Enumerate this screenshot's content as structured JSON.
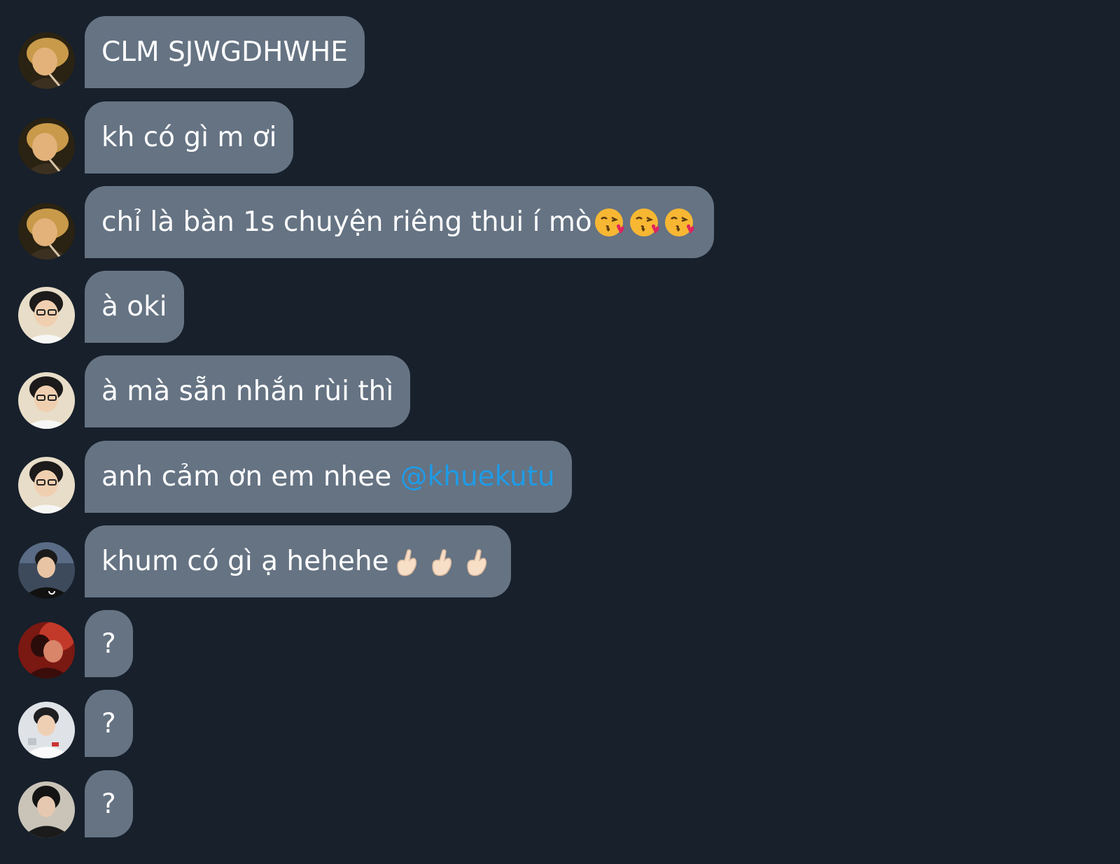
{
  "colors": {
    "background": "#17202b",
    "bubble": "#657383",
    "text": "#ffffff",
    "mention": "#1f9be6"
  },
  "messages": [
    {
      "text": "CLM SJWGDHWHE",
      "avatar": "avatar-blond"
    },
    {
      "text": "kh có gì m ơi",
      "avatar": "avatar-blond"
    },
    {
      "text": "chỉ là bàn 1s chuyện riêng thui í mò",
      "emoji": "kiss-emoji",
      "emoji_count": 3,
      "avatar": "avatar-blond"
    },
    {
      "text": "à oki",
      "avatar": "avatar-glasses"
    },
    {
      "text": "à mà sẵn nhắn rùi thì",
      "avatar": "avatar-glasses"
    },
    {
      "text": "anh cảm ơn em nhee ",
      "mention": "@khuekutu",
      "avatar": "avatar-glasses"
    },
    {
      "text": "khum có gì ạ hehehe",
      "emoji": "finger-heart-emoji",
      "emoji_count": 3,
      "avatar": "avatar-black-shirt"
    },
    {
      "text": "?",
      "avatar": "avatar-red"
    },
    {
      "text": "?",
      "avatar": "avatar-white-shirt"
    },
    {
      "text": "?",
      "avatar": "avatar-dark"
    }
  ]
}
